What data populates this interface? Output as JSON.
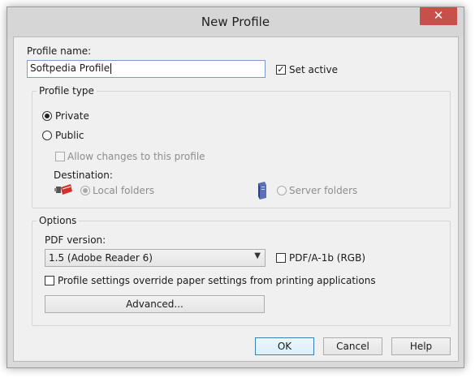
{
  "window": {
    "title": "New Profile",
    "close_glyph": "✕"
  },
  "profile_name": {
    "label": "Profile name:",
    "value": "Softpedia Profile",
    "set_active_label": "Set active",
    "set_active_checked": true
  },
  "profile_type": {
    "legend": "Profile type",
    "private_label": "Private",
    "public_label": "Public",
    "selected": "Private",
    "allow_changes_label": "Allow changes to this profile",
    "destination_label": "Destination:",
    "local_folders_label": "Local folders",
    "server_folders_label": "Server folders"
  },
  "options": {
    "legend": "Options",
    "pdf_version_label": "PDF version:",
    "pdf_version_value": "1.5 (Adobe Reader 6)",
    "pdfa_label": "PDF/A-1b (RGB)",
    "override_label": "Profile settings override paper settings from printing applications",
    "advanced_label": "Advanced..."
  },
  "buttons": {
    "ok": "OK",
    "cancel": "Cancel",
    "help": "Help"
  },
  "colors": {
    "close_button": "#c7504b",
    "default_button_border": "#3c7fb1"
  }
}
